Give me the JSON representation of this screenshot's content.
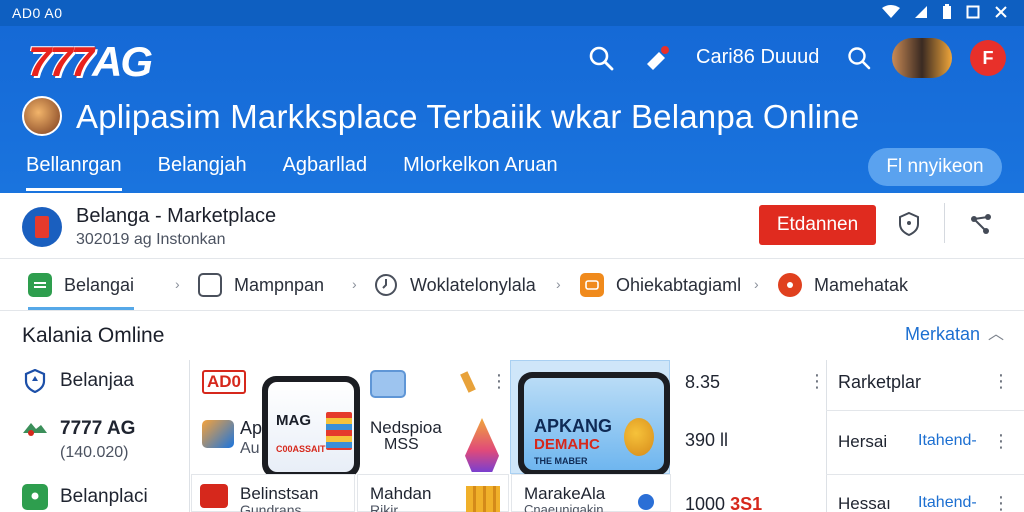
{
  "status_bar": {
    "time": "AD0 A0"
  },
  "header": {
    "logo_sevens": "777",
    "logo_ag": "AG",
    "user_label": "Cari86 Duuud",
    "brand_badge": "F",
    "headline": "Aplipasim Markksplace Terbaiik wkar Belanpa Online",
    "tabs": [
      {
        "label": "Bellanrgan",
        "active": true
      },
      {
        "label": "Belangjah"
      },
      {
        "label": "Agbarllad"
      },
      {
        "label": "Mlorkelkon Aruan"
      }
    ],
    "cta": "Fl nnyikeon"
  },
  "store": {
    "name": "Belanga - Marketplace",
    "sub": "302019 ag Instonkan",
    "button": "Etdannen"
  },
  "categories": [
    {
      "label": "Belangai",
      "active": true
    },
    {
      "label": "Mampnpan"
    },
    {
      "label": "Woklatelonylala"
    },
    {
      "label": "Ohiekabtagiaml"
    },
    {
      "label": "Mamehatak"
    }
  ],
  "section": {
    "title": "Kalania Omline",
    "link": "Merkatan"
  },
  "left_list": [
    {
      "label": "Belanjaa"
    },
    {
      "label": "7777 AG",
      "sub": "(140.020)"
    },
    {
      "label": "Belanplaci"
    }
  ],
  "tiles": {
    "col1_row1_label": "AD0",
    "col1_row2_label": "Ap",
    "col1_row2_sub": "Au",
    "col1_row3_label": "Belinstsan",
    "col1_row3_sub": "Gundrans",
    "phone1_title": "MAG",
    "phone1_sub": "C00ASSAIT",
    "col2_row2_label": "Nedspioa",
    "col2_row2_sub": "MSS",
    "col2_row3_label": "Mahdan",
    "col2_row3_sub": "Rikir",
    "phone2_title": "APKANG",
    "phone2_sub": "DEMAHC",
    "phone2_small": "THE MABER",
    "col3_row3_label": "MarakeAla",
    "col3_row3_sub": "Cnaeunigakin"
  },
  "right_cells": {
    "r1_value": "8.35",
    "r2_value": "390 ll",
    "r3_value_prefix": "1000",
    "r3_value_red": "3S1",
    "r1_label": "Rarketplar",
    "r2_label": "Hersai",
    "r2_link": "Itahend-",
    "r3_label": "Hessaı",
    "r3_link": "Itahend-"
  },
  "colors": {
    "header_blue": "#1569d6",
    "status_blue": "#0e5fc1",
    "cta_red": "#e02b1f",
    "link_blue": "#1c6fd1"
  }
}
